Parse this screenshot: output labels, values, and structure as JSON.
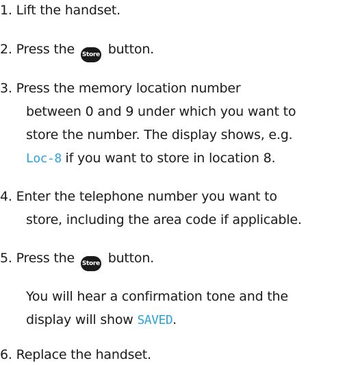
{
  "steps": [
    {
      "number": "1.",
      "text": "Lift the handset."
    },
    {
      "number": "2.",
      "before": "Press the",
      "button": "Store",
      "after": "button."
    },
    {
      "number": "3.",
      "line1": "Press the memory location number",
      "line2": "between 0 and 9 under which you want to",
      "line3": "store the number. The display shows, e.g.",
      "line4_display": "Loc-8",
      "line4_after": "if you want to store in location 8."
    },
    {
      "number": "4.",
      "line1": "Enter the telephone number you want to",
      "line2": "store, including the area code if applicable."
    },
    {
      "number": "5.",
      "before": "Press the",
      "button": "Store",
      "after": "button."
    },
    {
      "note_line1": "You will hear a confirmation tone and the",
      "note_line2_before": "display will show",
      "note_line2_display": "SAVED",
      "note_line2_after": "."
    },
    {
      "number": "6.",
      "text": "Replace the handset."
    }
  ],
  "colors": {
    "text": "#1a1a1a",
    "display_text": "#29a3df",
    "button_fill": "#1a1a1a"
  }
}
